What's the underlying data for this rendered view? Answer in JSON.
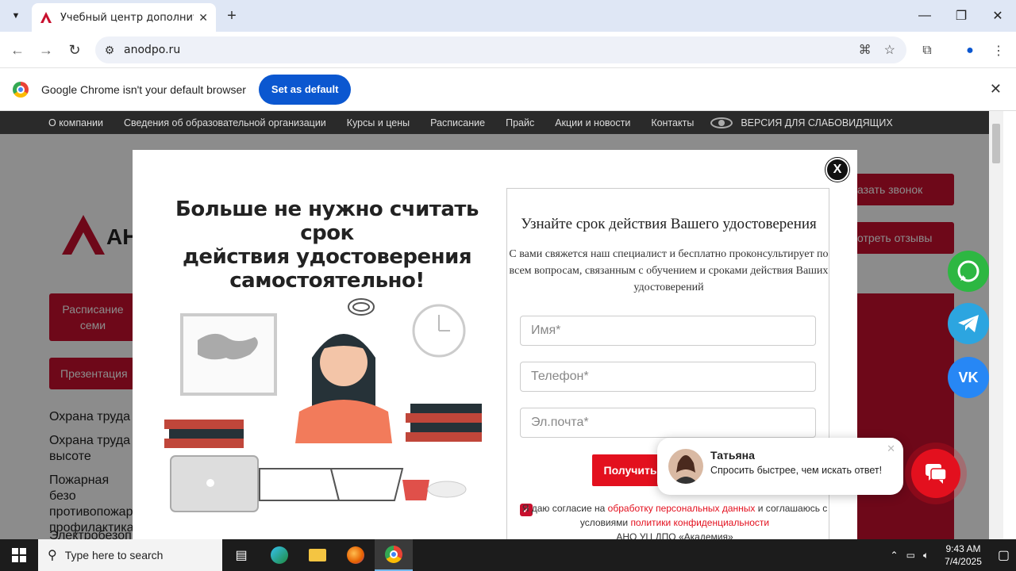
{
  "browser": {
    "tab_title": "Учебный центр дополнительн",
    "url": "anodpo.ru",
    "infobar_message": "Google Chrome isn't your default browser",
    "set_default_label": "Set as default"
  },
  "site_nav": {
    "items": [
      "О компании",
      "Сведения об образовательной организации",
      "Курсы и цены",
      "Расписание",
      "Прайс",
      "Акции и новости",
      "Контакты"
    ],
    "accessibility_label": "ВЕРСИЯ ДЛЯ СЛАБОВИДЯЩИХ"
  },
  "background": {
    "logo_text": "АН",
    "btn_schedule": "Расписание семи",
    "btn_presentation": "Презентация",
    "btn_callback": "азать звонок",
    "btn_reviews": "отреть отзывы",
    "list": [
      "Охрана труда",
      "Охрана труда высоте",
      "Пожарная безо противопожар профилактика",
      "Электробезоп"
    ]
  },
  "modal": {
    "promo_title_lines": [
      "Больше не нужно считать срок",
      "действия удостоверения",
      "самостоятельно!"
    ],
    "close_label": "X",
    "form_title": "Узнайте срок действия Вашего удостоверения",
    "form_desc": "С вами свяжется наш специалист и бесплатно проконсультирует по всем вопросам, связанным с обучением и сроками действия Ваших удостоверений",
    "name_placeholder": "Имя*",
    "phone_placeholder": "Телефон*",
    "email_placeholder": "Эл.почта*",
    "submit_label": "Получить",
    "consent_prefix": "Я даю согласие на",
    "consent_link1": "обработку персональных данных",
    "consent_mid": "и соглашаюсь с условиями",
    "consent_link2": "политики конфиденциальности",
    "consent_org": "АНО УЦ ДПО «Академия»"
  },
  "chat": {
    "agent_name": "Татьяна",
    "message": "Спросить быстрее, чем искать ответ!"
  },
  "taskbar": {
    "search_placeholder": "Type here to search",
    "time": "9:43 AM",
    "date": "7/4/2025"
  },
  "colors": {
    "brand_red": "#c8102e",
    "chrome_blue": "#0b57d0"
  }
}
